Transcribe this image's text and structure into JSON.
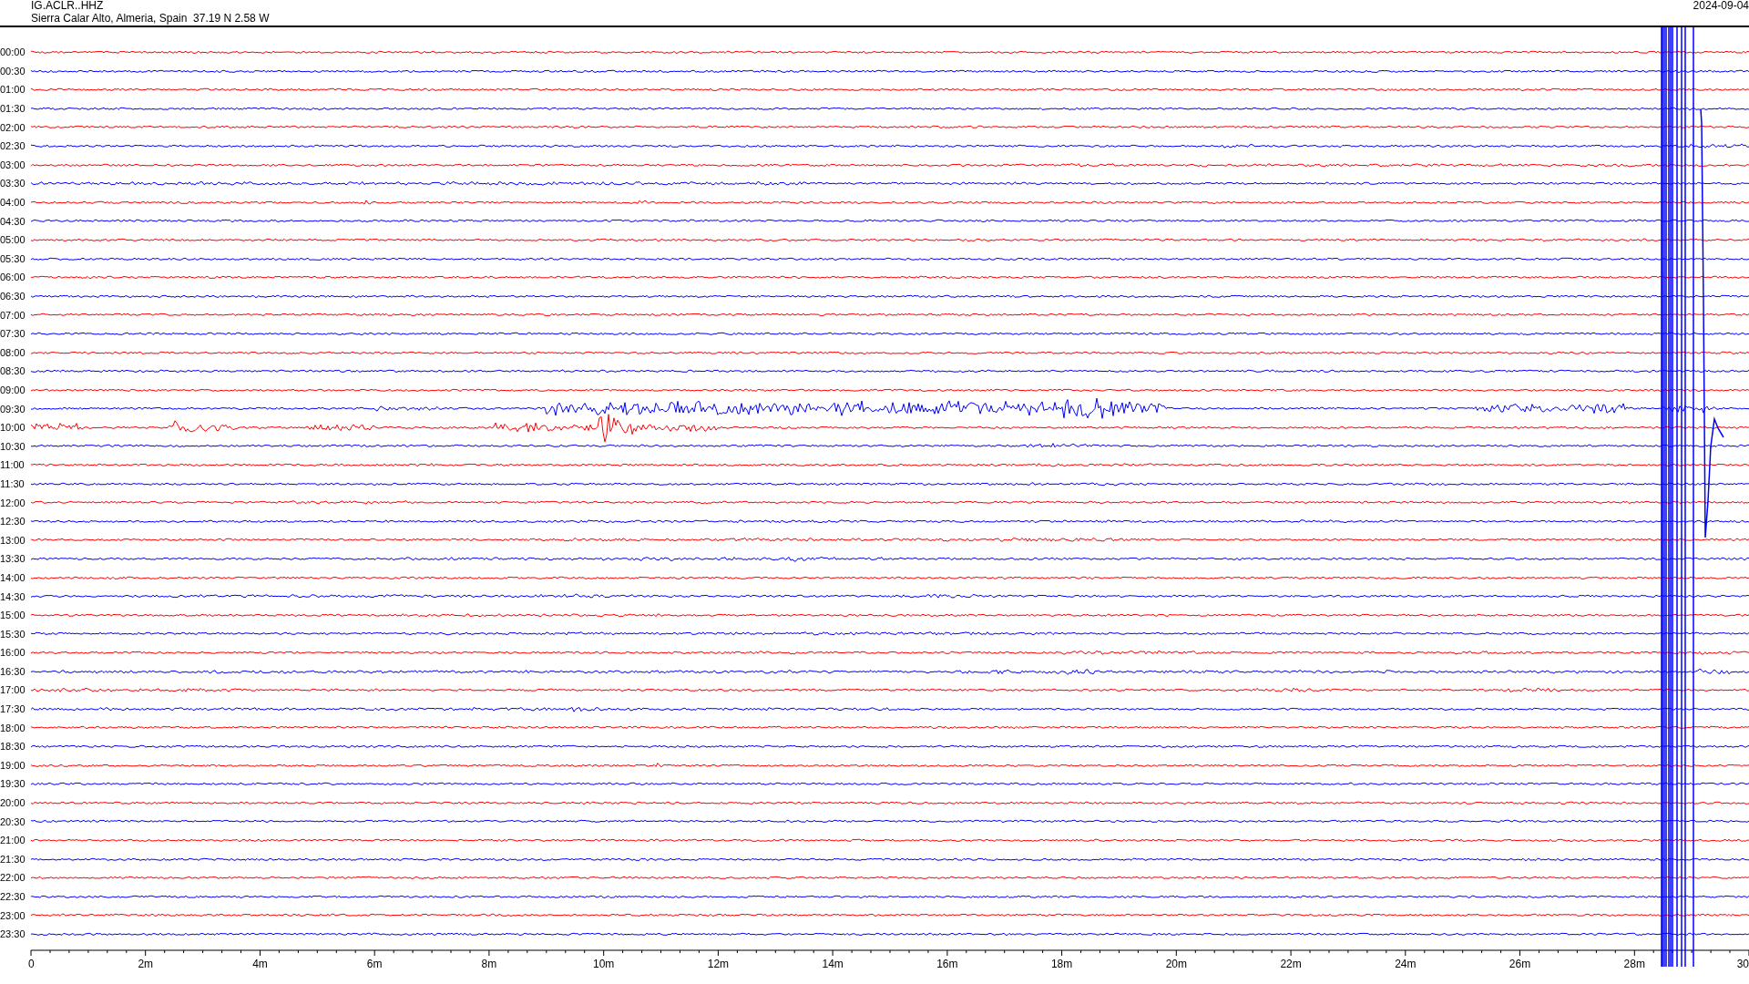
{
  "header": {
    "station": "IG.ACLR..HHZ",
    "location": "Sierra Calar Alto, Almeria, Spain  37.19 N 2.58 W",
    "date": "2024-09-04"
  },
  "rows": [
    {
      "time": "00:00",
      "color": "#ff0000"
    },
    {
      "time": "00:30",
      "color": "#0000ff"
    },
    {
      "time": "01:00",
      "color": "#ff0000"
    },
    {
      "time": "01:30",
      "color": "#0000ff"
    },
    {
      "time": "02:00",
      "color": "#ff0000"
    },
    {
      "time": "02:30",
      "color": "#0000ff"
    },
    {
      "time": "03:00",
      "color": "#ff0000"
    },
    {
      "time": "03:30",
      "color": "#0000ff"
    },
    {
      "time": "04:00",
      "color": "#ff0000"
    },
    {
      "time": "04:30",
      "color": "#0000ff"
    },
    {
      "time": "05:00",
      "color": "#ff0000"
    },
    {
      "time": "05:30",
      "color": "#0000ff"
    },
    {
      "time": "06:00",
      "color": "#ff0000"
    },
    {
      "time": "06:30",
      "color": "#0000ff"
    },
    {
      "time": "07:00",
      "color": "#ff0000"
    },
    {
      "time": "07:30",
      "color": "#0000ff"
    },
    {
      "time": "08:00",
      "color": "#ff0000"
    },
    {
      "time": "08:30",
      "color": "#0000ff"
    },
    {
      "time": "09:00",
      "color": "#ff0000"
    },
    {
      "time": "09:30",
      "color": "#0000ff"
    },
    {
      "time": "10:00",
      "color": "#ff0000"
    },
    {
      "time": "10:30",
      "color": "#0000ff"
    },
    {
      "time": "11:00",
      "color": "#ff0000"
    },
    {
      "time": "11:30",
      "color": "#0000ff"
    },
    {
      "time": "12:00",
      "color": "#ff0000"
    },
    {
      "time": "12:30",
      "color": "#0000ff"
    },
    {
      "time": "13:00",
      "color": "#ff0000"
    },
    {
      "time": "13:30",
      "color": "#0000ff"
    },
    {
      "time": "14:00",
      "color": "#ff0000"
    },
    {
      "time": "14:30",
      "color": "#0000ff"
    },
    {
      "time": "15:00",
      "color": "#ff0000"
    },
    {
      "time": "15:30",
      "color": "#0000ff"
    },
    {
      "time": "16:00",
      "color": "#ff0000"
    },
    {
      "time": "16:30",
      "color": "#0000ff"
    },
    {
      "time": "17:00",
      "color": "#ff0000"
    },
    {
      "time": "17:30",
      "color": "#0000ff"
    },
    {
      "time": "18:00",
      "color": "#ff0000"
    },
    {
      "time": "18:30",
      "color": "#0000ff"
    },
    {
      "time": "19:00",
      "color": "#ff0000"
    },
    {
      "time": "19:30",
      "color": "#0000ff"
    },
    {
      "time": "20:00",
      "color": "#ff0000"
    },
    {
      "time": "20:30",
      "color": "#0000ff"
    },
    {
      "time": "21:00",
      "color": "#ff0000"
    },
    {
      "time": "21:30",
      "color": "#0000ff"
    },
    {
      "time": "22:00",
      "color": "#ff0000"
    },
    {
      "time": "22:30",
      "color": "#0000ff"
    },
    {
      "time": "23:00",
      "color": "#ff0000"
    },
    {
      "time": "23:30",
      "color": "#0000ff"
    }
  ],
  "x_axis": {
    "labels": [
      "0",
      "2m",
      "4m",
      "6m",
      "8m",
      "10m",
      "12m",
      "14m",
      "16m",
      "18m",
      "20m",
      "22m",
      "24m",
      "26m",
      "28m",
      "30"
    ]
  }
}
